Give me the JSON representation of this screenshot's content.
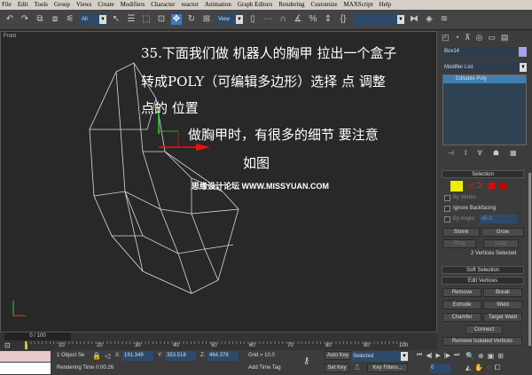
{
  "menu": [
    "File",
    "Edit",
    "Tools",
    "Group",
    "Views",
    "Create",
    "Modifiers",
    "Character",
    "reactor",
    "Animation",
    "Graph Editors",
    "Rendering",
    "Customize",
    "MAXScript",
    "Help"
  ],
  "toolbar": {
    "selection_filter": "All",
    "ref_coord": "View"
  },
  "viewport": {
    "label": "Front",
    "axis_y": "y"
  },
  "overlay_text": {
    "line1": "35.下面我们做 机器人的胸甲 拉出一个盒子",
    "line2": "转成POLY（可编辑多边形）选择 点 调整",
    "line3": "点的 位置",
    "line4": "做胸甲时，有很多的细节 要注意",
    "line5": "如图",
    "watermark": "思缘设计论坛 WWW.MISSYUAN.COM"
  },
  "command_panel": {
    "object_name": "Box14",
    "object_color": "#a8a0e8",
    "modifier_list": "Modifier List",
    "stack_item": "Editable Poly",
    "selection_title": "Selection",
    "by_vertex": "By Vertex",
    "ignore_backfacing": "Ignore Backfacing",
    "by_angle": "By Angle:",
    "angle_value": "45.0",
    "shrink": "Shrink",
    "grow": "Grow",
    "ring": "Ring",
    "loop": "Loop",
    "selected_info": "2 Vertices Selected",
    "soft_selection": "Soft Selection",
    "edit_vertices": "Edit Vertices",
    "remove": "Remove",
    "break": "Break",
    "extrude": "Extrude",
    "weld": "Weld",
    "chamfer": "Chamfer",
    "target_weld": "Target Weld",
    "connect": "Connect",
    "remove_isolated": "Remove Isolated Vertices"
  },
  "timeline": {
    "frame": "0 / 100",
    "ticks": [
      "10",
      "20",
      "30",
      "40",
      "50",
      "60",
      "70",
      "80",
      "90",
      "100"
    ]
  },
  "status": {
    "objects": "1 Object Se",
    "x_label": "X:",
    "x": "191.349",
    "y_label": "Y:",
    "y": "353.518",
    "z_label": "Z:",
    "z": "464.378",
    "grid": "Grid = 10.0",
    "rendering_time": "Rendering Time  0:00:26",
    "add_time_tag": "Add Time Tag",
    "auto_key": "Auto Key",
    "set_key": "Set Key",
    "key_mode": "Selected",
    "key_filters": "Key Filters...",
    "frame_field": "0"
  }
}
